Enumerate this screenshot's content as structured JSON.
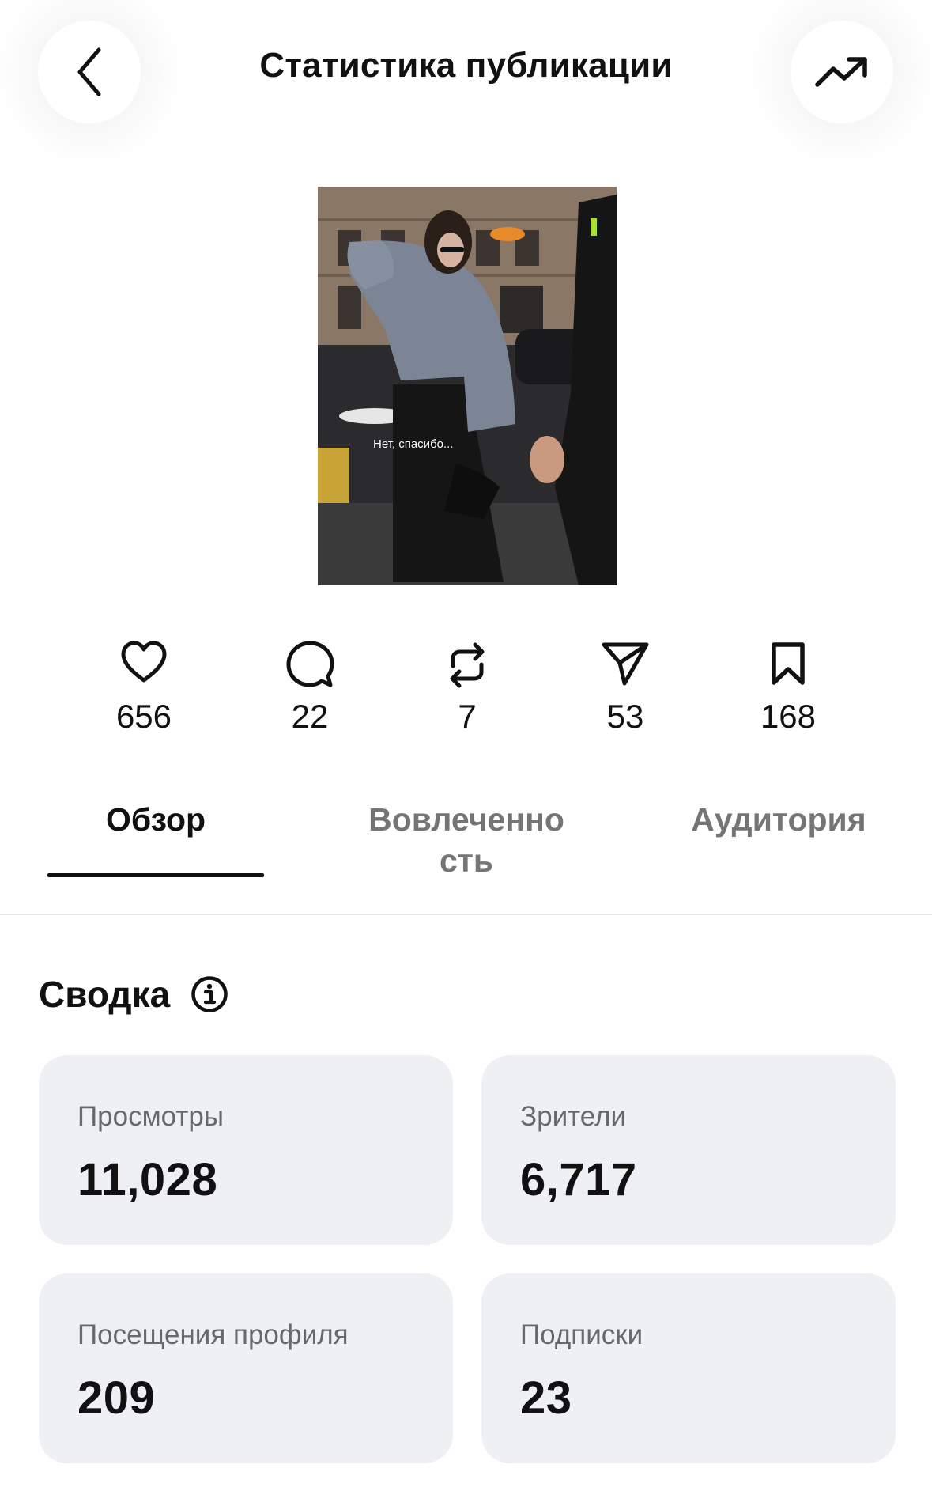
{
  "header": {
    "title": "Статистика публикации",
    "back_icon": "chevron-left-icon",
    "trend_icon": "trending-up-icon"
  },
  "post": {
    "caption": "Нет, спасибо..."
  },
  "metrics": [
    {
      "icon": "heart-icon",
      "value": "656"
    },
    {
      "icon": "comment-icon",
      "value": "22"
    },
    {
      "icon": "repost-icon",
      "value": "7"
    },
    {
      "icon": "share-icon",
      "value": "53"
    },
    {
      "icon": "bookmark-icon",
      "value": "168"
    }
  ],
  "tabs": [
    {
      "label": "Обзор",
      "active": true
    },
    {
      "label": "Вовлеченно\nсть",
      "active": false
    },
    {
      "label": "Аудитория",
      "active": false
    }
  ],
  "summary": {
    "title": "Сводка",
    "info_icon": "info-icon",
    "cards": [
      {
        "label": "Просмотры",
        "value": "11,028"
      },
      {
        "label": "Зрители",
        "value": "6,717"
      },
      {
        "label": "Посещения профиля",
        "value": "209"
      },
      {
        "label": "Подписки",
        "value": "23"
      }
    ]
  },
  "colors": {
    "text": "#111111",
    "muted": "#757575",
    "card_bg": "#eff0f4",
    "card_label": "#666a70"
  }
}
